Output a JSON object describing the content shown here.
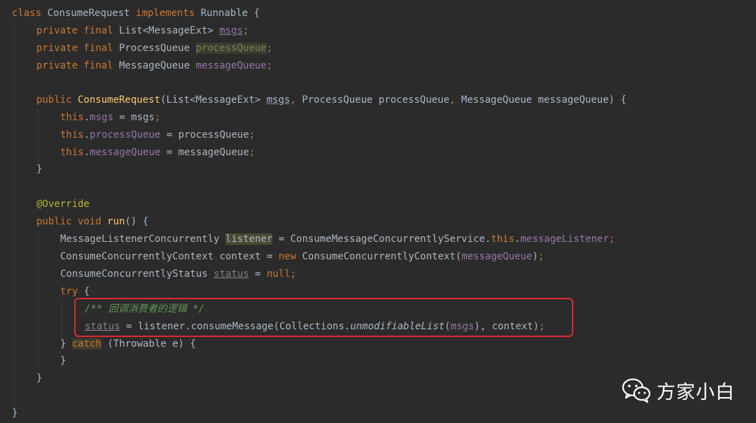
{
  "code": {
    "l1": {
      "kw_class": "class",
      "class_name": " ConsumeRequest ",
      "kw_impl": "implements",
      "iface": " Runnable {"
    },
    "l2": {
      "mods": "private final",
      "type": " List<MessageExt> ",
      "field": "msgs",
      "semi": ";"
    },
    "l3": {
      "mods": "private final",
      "type": " ProcessQueue ",
      "field": "processQueue",
      "semi": ";"
    },
    "l4": {
      "mods": "private final",
      "type": " MessageQueue ",
      "field": "messageQueue",
      "semi": ";"
    },
    "l6": {
      "mods": "public",
      "ctor": " ConsumeRequest",
      "p1": "(List<MessageExt> ",
      "msgs": "msgs",
      "comma1": ",",
      "p2": " ProcessQueue processQueue",
      "comma2": ",",
      "p3": " MessageQueue messageQueue) {"
    },
    "l7": {
      "this": "this",
      "dot": ".",
      "field": "msgs",
      "rest": " = msgs",
      "semi": ";"
    },
    "l8": {
      "this": "this",
      "dot": ".",
      "field": "processQueue",
      "rest": " = processQueue",
      "semi": ";"
    },
    "l9": {
      "this": "this",
      "dot": ".",
      "field": "messageQueue",
      "rest": " = messageQueue",
      "semi": ";"
    },
    "l10": {
      "brace": "}"
    },
    "l12": {
      "annotation": "@Override"
    },
    "l13": {
      "mods": "public void",
      "method": " run",
      "rest": "() {"
    },
    "l14": {
      "type": "MessageListenerConcurrently ",
      "var": "listener",
      "rest": " = ConsumeMessageConcurrentlyService.",
      "this": "this",
      "dot": ".",
      "field": "messageListener",
      "semi": ";"
    },
    "l15": {
      "type": "ConsumeConcurrentlyContext context = ",
      "kw_new": "new",
      "rest": " ConsumeConcurrentlyContext(",
      "arg": "messageQueue",
      "close": ")",
      "semi": ";"
    },
    "l16": {
      "type": "ConsumeConcurrentlyStatus ",
      "var": "status",
      "rest": " = ",
      "kw_null": "null",
      "semi": ";"
    },
    "l17": {
      "kw_try": "try",
      "rest": " {"
    },
    "l18": {
      "comment": "/** 回调消费者的逻辑 */"
    },
    "l19": {
      "var": "status",
      "rest": " = listener.consumeMessage(Collections.",
      "static": "unmodifiableList",
      "open": "(",
      "arg": "msgs",
      "close": "), context)",
      "semi": ";"
    },
    "l20": {
      "brace": "} ",
      "kw_catch": "catch",
      "rest": " (Throwable e) {"
    },
    "l21": {
      "brace": "}"
    },
    "l22": {
      "brace": "}"
    },
    "l24": {
      "brace": "}"
    }
  },
  "watermark": {
    "text": "方家小白",
    "icon": "wechat-icon"
  },
  "colors": {
    "background": "#2b2b2b",
    "keyword": "#cc7832",
    "field": "#9876aa",
    "method": "#ffc66d",
    "annotation": "#bbb529",
    "comment": "#629755",
    "text": "#a9b7c6",
    "highlight_box": "#e0282c"
  }
}
